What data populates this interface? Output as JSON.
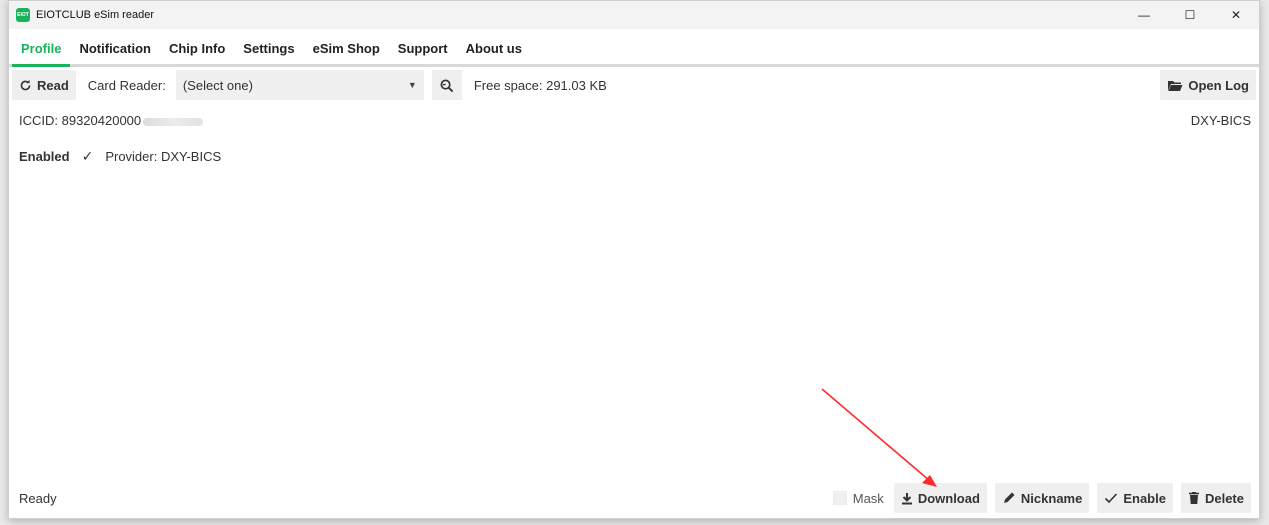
{
  "window": {
    "app_icon_text": "EIOT",
    "title": "EIOTCLUB eSim reader",
    "minimize": "—",
    "maximize": "☐",
    "close": "✕"
  },
  "tabs": [
    {
      "label": "Profile",
      "active": true
    },
    {
      "label": "Notification"
    },
    {
      "label": "Chip Info"
    },
    {
      "label": "Settings"
    },
    {
      "label": "eSim Shop"
    },
    {
      "label": "Support"
    },
    {
      "label": "About us"
    }
  ],
  "toolbar": {
    "read_label": "Read",
    "card_reader_label": "Card Reader:",
    "card_reader_value": "(Select one)",
    "free_space": "Free space: 291.03 KB",
    "open_log_label": "Open Log"
  },
  "profile": {
    "iccid": "ICCID: 89320420000",
    "provider_right": "DXY-BICS",
    "status": "Enabled",
    "provider": "Provider: DXY-BICS"
  },
  "statusbar": {
    "status": "Ready",
    "mask_label": "Mask",
    "download_label": "Download",
    "nickname_label": "Nickname",
    "enable_label": "Enable",
    "delete_label": "Delete"
  },
  "colors": {
    "accent": "#18b35a",
    "annotation_arrow": "#ff2a2a"
  }
}
